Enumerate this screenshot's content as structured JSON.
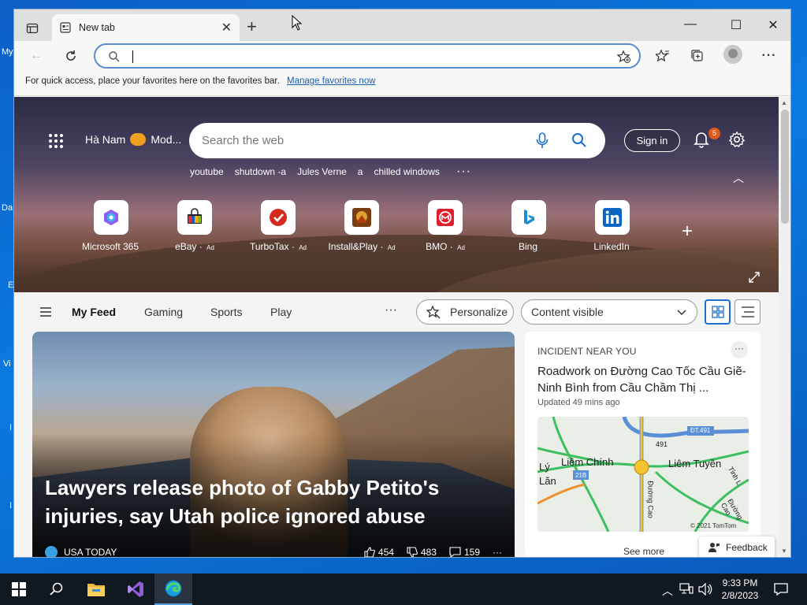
{
  "desktop": {
    "labels": [
      "My",
      "Da",
      "E",
      "Vi",
      "I",
      "I"
    ]
  },
  "browser": {
    "tab": {
      "title": "New tab"
    },
    "address": {
      "value": ""
    },
    "favorites_bar": {
      "message": "For quick access, place your favorites here on the favorites bar.",
      "link": "Manage favorites now"
    }
  },
  "newtab": {
    "weather": {
      "location": "Hà Nam",
      "condition": "Mod..."
    },
    "search": {
      "placeholder": "Search the web"
    },
    "trending": [
      "youtube",
      "shutdown -a",
      "Jules Verne",
      "a",
      "chilled windows"
    ],
    "sign_in": "Sign in",
    "notification_count": "5",
    "quick_links": [
      {
        "label": "Microsoft 365",
        "ad": "",
        "icon": "microsoft-365-icon"
      },
      {
        "label": "eBay",
        "ad": "Ad",
        "icon": "ebay-icon"
      },
      {
        "label": "TurboTax",
        "ad": "Ad",
        "icon": "turbotax-icon"
      },
      {
        "label": "Install&Play",
        "ad": "Ad",
        "icon": "install-play-icon"
      },
      {
        "label": "BMO",
        "ad": "Ad",
        "icon": "bmo-icon"
      },
      {
        "label": "Bing",
        "ad": "",
        "icon": "bing-icon"
      },
      {
        "label": "LinkedIn",
        "ad": "",
        "icon": "linkedin-icon"
      }
    ],
    "feed_nav": {
      "tabs": [
        "My Feed",
        "Gaming",
        "Sports",
        "Play"
      ],
      "personalize": "Personalize",
      "content_select": "Content visible"
    },
    "main_card": {
      "headline": "Lawyers release photo of Gabby Petito's injuries, say Utah police ignored abuse",
      "source": "USA TODAY",
      "likes": "454",
      "dislikes": "483",
      "comments": "159"
    },
    "side_card": {
      "kicker": "INCIDENT NEAR YOU",
      "title": "Roadwork on Đường Cao Tốc Cầu Giẽ-Ninh Bình from Cầu Chầm Thị ...",
      "updated": "Updated 49 mins ago",
      "map_labels": [
        "Liêm Chính",
        "Liêm Tuyền",
        "ĐT.491",
        "21B",
        "Lý",
        "Lăn",
        "Đường Cao",
        "Tỉnh L",
        "Đường Cao",
        "491"
      ],
      "map_copyright": "© 2021 TomTom",
      "see_more": "See more"
    },
    "feedback": "Feedback"
  },
  "taskbar": {
    "time": "9:33 PM",
    "date": "2/8/2023"
  },
  "colors": {
    "accent": "#1a6fd1",
    "taskbar": "#101820",
    "desktop": "#0a66c2",
    "notification_badge": "#e05a1c"
  }
}
